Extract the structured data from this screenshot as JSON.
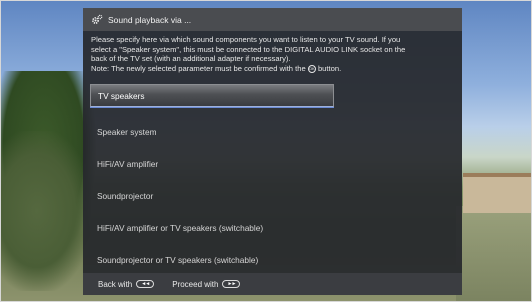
{
  "dialog": {
    "title": "Sound playback via ...",
    "description_line1": "Please specify here via which sound components you want to listen to your TV sound. If you",
    "description_line2": "select a \"Speaker system\", this must be connected to the DIGITAL AUDIO LINK socket on the",
    "description_line3": "back of the TV set (with an additional adapter if necessary).",
    "description_line4_pre": "Note: The newly selected parameter must be confirmed with the",
    "description_line4_post": "button.",
    "ok_icon_glyph": "OK"
  },
  "menu": {
    "items": [
      {
        "label": "TV speakers",
        "selected": true
      },
      {
        "label": "Speaker system",
        "selected": false
      },
      {
        "label": "HiFi/AV amplifier",
        "selected": false
      },
      {
        "label": "Soundprojector",
        "selected": false
      },
      {
        "label": "HiFi/AV amplifier or TV speakers (switchable)",
        "selected": false
      },
      {
        "label": "Soundprojector or TV speakers (switchable)",
        "selected": false
      }
    ]
  },
  "footer": {
    "back_label": "Back with",
    "back_icon_glyph": "◄◄",
    "proceed_label": "Proceed with",
    "proceed_icon_glyph": "►►"
  },
  "icons": {
    "title_icon": "gear-icon",
    "back_icon": "rewind-button-icon",
    "proceed_icon": "fast-forward-button-icon",
    "ok_icon": "ok-button-icon"
  },
  "colors": {
    "panel_bg": "#26282c",
    "title_bar_bg": "#4a4c50",
    "selection_underline": "#6b8bd6"
  }
}
